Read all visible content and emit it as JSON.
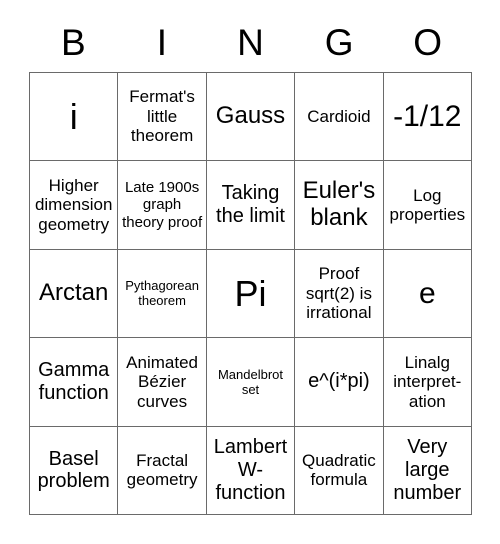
{
  "header": {
    "letters": [
      "B",
      "I",
      "N",
      "G",
      "O"
    ]
  },
  "colors": {
    "page_background": "#ffffff",
    "cell_background": "#ffffff",
    "grid_border": "#6a6a6a",
    "text": "#000000"
  },
  "grid": {
    "columns": 5,
    "rows": 5,
    "cells": [
      {
        "text": "i",
        "size": "fs-huge"
      },
      {
        "text": "Fermat's little theorem",
        "size": "fs-md"
      },
      {
        "text": "Gauss",
        "size": "fs-xl"
      },
      {
        "text": "Cardioid",
        "size": "fs-md"
      },
      {
        "text": "-1/12",
        "size": "fs-xxl"
      },
      {
        "text": "Higher dimension geometry",
        "size": "fs-md"
      },
      {
        "text": "Late 1900s graph theory proof",
        "size": "fs-sm"
      },
      {
        "text": "Taking the limit",
        "size": "fs-lg"
      },
      {
        "text": "Euler's blank",
        "size": "fs-xl"
      },
      {
        "text": "Log properties",
        "size": "fs-md"
      },
      {
        "text": "Arctan",
        "size": "fs-xl"
      },
      {
        "text": "Pythagorean theorem",
        "size": "fs-xs"
      },
      {
        "text": "Pi",
        "size": "fs-huge"
      },
      {
        "text": "Proof sqrt(2) is irrational",
        "size": "fs-md"
      },
      {
        "text": "e",
        "size": "fs-xxl"
      },
      {
        "text": "Gamma function",
        "size": "fs-lg"
      },
      {
        "text": "Animated Bézier curves",
        "size": "fs-md"
      },
      {
        "text": "Mandelbrot set",
        "size": "fs-xs"
      },
      {
        "text": "e^(i*pi)",
        "size": "fs-lg"
      },
      {
        "text": "Linalg interpret-\nation",
        "size": "fs-md"
      },
      {
        "text": "Basel problem",
        "size": "fs-lg"
      },
      {
        "text": "Fractal geometry",
        "size": "fs-md"
      },
      {
        "text": "Lambert W- function",
        "size": "fs-lg"
      },
      {
        "text": "Quadratic formula",
        "size": "fs-md"
      },
      {
        "text": "Very large number",
        "size": "fs-lg"
      }
    ]
  }
}
